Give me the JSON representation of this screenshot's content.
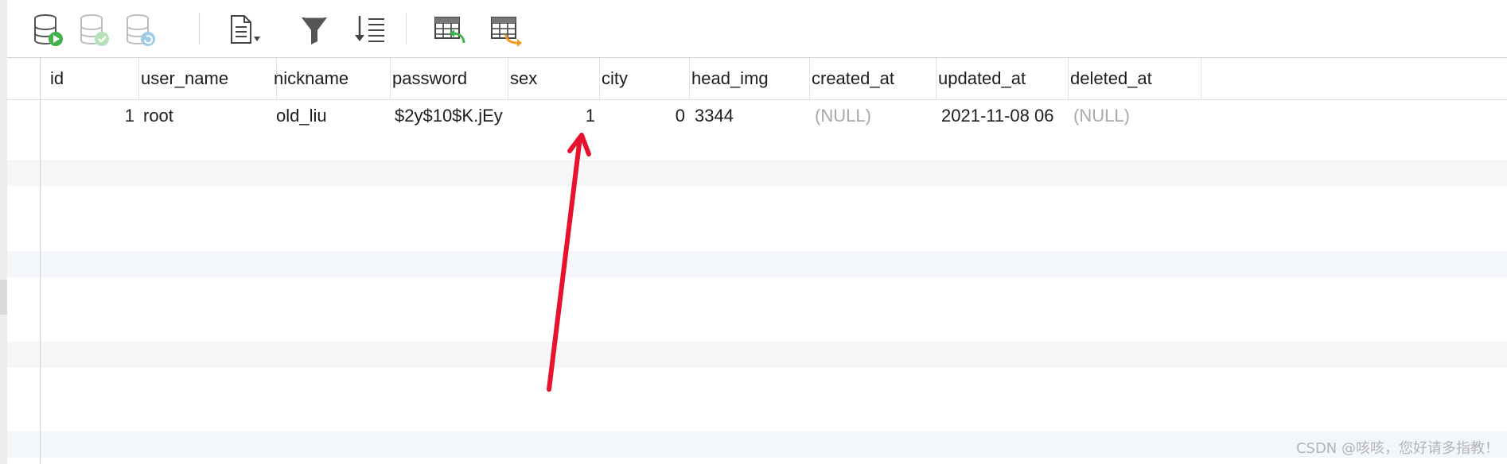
{
  "toolbar": {
    "icons": [
      "run-query-icon",
      "commit-icon",
      "refresh-icon",
      "export-icon",
      "filter-icon",
      "sort-icon",
      "import-table-icon",
      "export-table-icon"
    ],
    "colors": {
      "play": "#3fb24a",
      "check": "#7ecb7e",
      "refresh": "#4ea3d8",
      "arrow_orange": "#f39a1f"
    }
  },
  "table": {
    "columns": [
      "id",
      "user_name",
      "nickname",
      "password",
      "sex",
      "city",
      "head_img",
      "created_at",
      "updated_at",
      "deleted_at"
    ],
    "rows": [
      {
        "id": "1",
        "user_name": "root",
        "nickname": "old_liu",
        "password": "$2y$10$K.jEy",
        "sex": "1",
        "city": "0",
        "head_img": "3344",
        "created_at": "(NULL)",
        "updated_at": "2021-11-08 06",
        "deleted_at": "(NULL)"
      }
    ]
  },
  "annotation": {
    "arrow_color": "#e8122c"
  },
  "watermark": "CSDN @咳咳，您好请多指教！"
}
